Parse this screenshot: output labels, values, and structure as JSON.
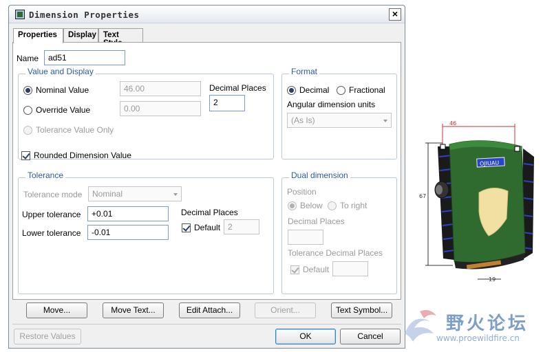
{
  "dialog": {
    "title": "Dimension Properties",
    "close_label": "×"
  },
  "tabs": [
    {
      "label": "Properties",
      "active": true
    },
    {
      "label": "Display",
      "active": false
    },
    {
      "label": "Text Style",
      "active": false
    }
  ],
  "properties": {
    "name_label": "Name",
    "name_value": "ad51",
    "value_display": {
      "title": "Value and Display",
      "nominal_label": "Nominal Value",
      "nominal_value": "46.00",
      "override_label": "Override Value",
      "override_value": "0.00",
      "tolerance_only_label": "Tolerance Value Only",
      "decimal_places_label": "Decimal Places",
      "decimal_places_value": "2",
      "rounded_label": "Rounded Dimension Value"
    },
    "format": {
      "title": "Format",
      "decimal_label": "Decimal",
      "fractional_label": "Fractional",
      "angular_label": "Angular dimension units",
      "angular_value": "(As Is)"
    },
    "tolerance": {
      "title": "Tolerance",
      "mode_label": "Tolerance mode",
      "mode_value": "Nominal",
      "upper_label": "Upper tolerance",
      "upper_value": "+0.01",
      "lower_label": "Lower tolerance",
      "lower_value": "-0.01",
      "decimal_places_label": "Decimal Places",
      "default_label": "Default",
      "default_value": "2"
    },
    "dual": {
      "title": "Dual dimension",
      "position_label": "Position",
      "below_label": "Below",
      "right_label": "To right",
      "decimal_places_label": "Decimal Places",
      "tol_decimal_label": "Tolerance Decimal Places",
      "default_label": "Default"
    }
  },
  "buttons": {
    "move": "Move...",
    "move_text": "Move Text...",
    "edit_attach": "Edit Attach...",
    "orient": "Orient...",
    "text_symbol": "Text Symbol...",
    "restore": "Restore Values",
    "ok": "OK",
    "cancel": "Cancel"
  },
  "model": {
    "dim_top": "46",
    "dim_side": "67",
    "dim_bottom": "19",
    "brand_text": "OJIUAU"
  },
  "watermark": {
    "cn_text": "野火论坛",
    "url": "www.proewildfire.cn"
  },
  "colors": {
    "accent": "#2c5aa0",
    "model_green": "#2f6b2f",
    "model_blue": "#2a44c8"
  }
}
